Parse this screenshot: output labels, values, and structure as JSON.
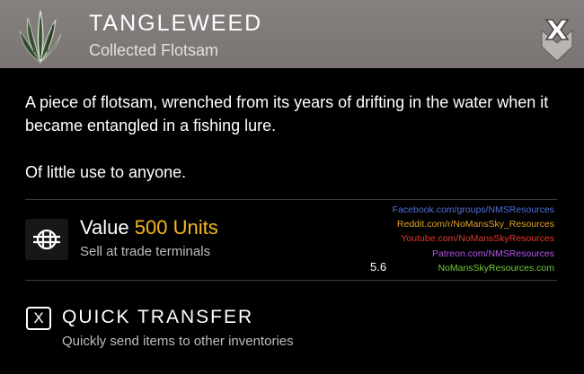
{
  "header": {
    "title": "TANGLEWEED",
    "subtitle": "Collected Flotsam",
    "item_icon": "tangleweed-icon",
    "close_icon": "close-x-icon",
    "bg_color": "#86807f"
  },
  "description": {
    "paragraph1": "A piece of flotsam, wrenched from its years of drifting in the water when it became entangled in a fishing lure.",
    "paragraph2": "Of little use to anyone."
  },
  "value": {
    "label": "Value",
    "amount": "500 Units",
    "amount_color": "#f6b81e",
    "sub": "Sell at trade terminals",
    "icon": "units-currency-icon"
  },
  "watermark": {
    "links": [
      {
        "text": "Facebook.com/groups/NMSResources",
        "color": "#4f6fd8"
      },
      {
        "text": "Reddit.com/r/NoMansSky_Resources",
        "color": "#e1a22a"
      },
      {
        "text": "Youtube.com/NoMansSkyResources",
        "color": "#e03a2a"
      },
      {
        "text": "Patreon.com/NMSResources",
        "color": "#b455e8"
      },
      {
        "text": "NoMansSkyResources.com",
        "color": "#76c93a"
      }
    ],
    "version": "5.6"
  },
  "quick_transfer": {
    "key": "X",
    "title": "QUICK TRANSFER",
    "sub": "Quickly send items to other inventories"
  }
}
